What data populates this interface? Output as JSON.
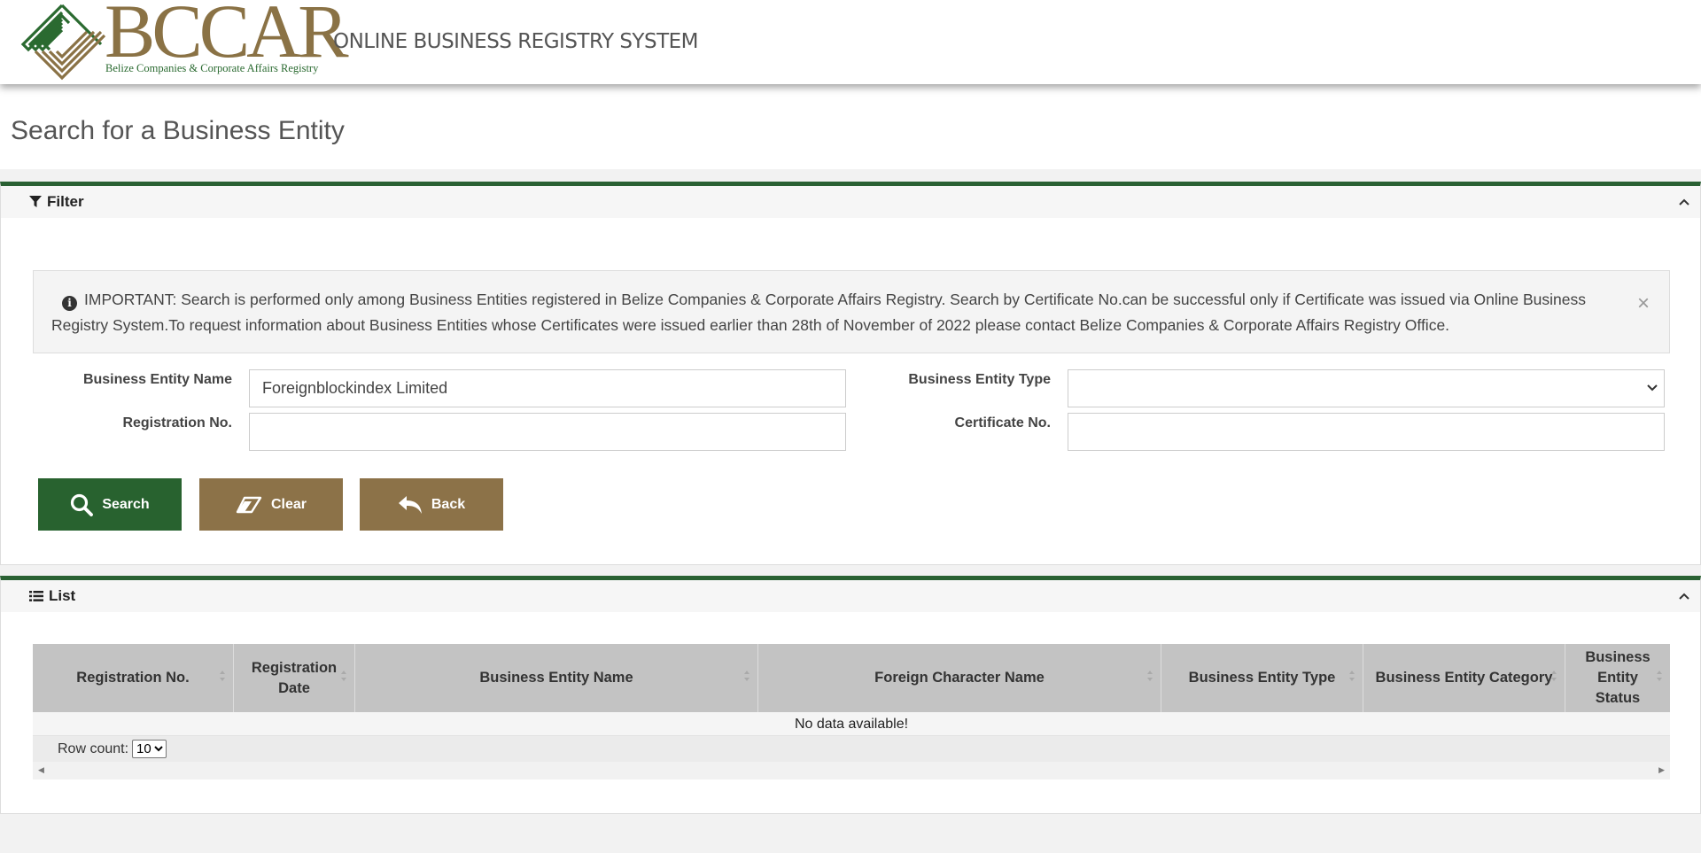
{
  "header": {
    "logo_text": "BCCAR",
    "logo_subtitle": "Belize Companies & Corporate Affairs Registry",
    "app_title": "ONLINE BUSINESS REGISTRY SYSTEM"
  },
  "page": {
    "title": "Search for a Business Entity"
  },
  "filter_panel": {
    "title": "Filter",
    "alert": "IMPORTANT: Search is performed only among Business Entities registered in Belize Companies & Corporate Affairs Registry. Search by Certificate No.can be successful only if Certificate was issued via Online Business Registry System.To request information about Business Entities whose Certificates were issued earlier than 28th of November of 2022 please contact Belize Companies & Corporate Affairs Registry Office.",
    "close_symbol": "×",
    "fields": {
      "entity_name_label": "Business Entity Name",
      "entity_name_value": "Foreignblockindex Limited",
      "entity_type_label": "Business Entity Type",
      "entity_type_value": "",
      "registration_no_label": "Registration No.",
      "registration_no_value": "",
      "certificate_no_label": "Certificate No.",
      "certificate_no_value": ""
    },
    "buttons": {
      "search": "Search",
      "clear": "Clear",
      "back": "Back"
    }
  },
  "list_panel": {
    "title": "List",
    "columns": [
      "Registration No.",
      "Registration Date",
      "Business Entity Name",
      "Foreign Character Name",
      "Business Entity Type",
      "Business Entity Category",
      "Business Entity Status"
    ],
    "empty_text": "No data available!",
    "row_count_label": "Row count:",
    "row_count_value": "10"
  },
  "colors": {
    "primary_green": "#28622f",
    "accent_brown": "#8c7248",
    "header_gray": "#c3c3c3"
  }
}
